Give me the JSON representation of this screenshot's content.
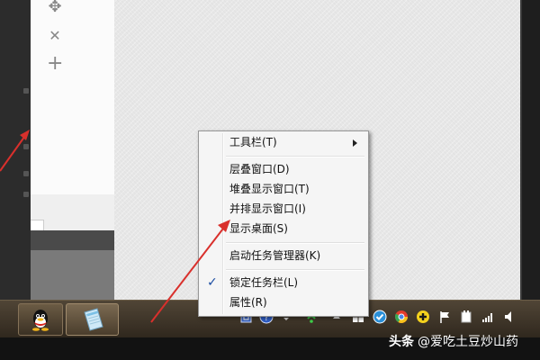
{
  "context_menu": {
    "items": [
      {
        "label": "工具栏(T)",
        "submenu": true
      },
      {
        "label": "层叠窗口(D)"
      },
      {
        "label": "堆叠显示窗口(T)"
      },
      {
        "label": "并排显示窗口(I)"
      },
      {
        "label": "显示桌面(S)"
      },
      {
        "label": "启动任务管理器(K)"
      },
      {
        "label": "锁定任务栏(L)",
        "checked": true,
        "check_mark": "✓"
      },
      {
        "label": "属性(R)"
      }
    ]
  },
  "side_tools": {
    "move_glyph": "✥",
    "close_glyph": "✕",
    "add_glyph": "+"
  },
  "taskbar": {
    "buttons": [
      "qq-icon",
      "notepad-icon"
    ],
    "tray_icons": [
      "keyboard-icon",
      "help-icon",
      "overflow-arrow-icon",
      "wifi-icon",
      "up-arrow-icon",
      "windows-icon",
      "check-icon",
      "chrome-icon",
      "plus-icon",
      "flag-icon",
      "device-icon",
      "signal-icon",
      "speaker-icon"
    ]
  },
  "watermark": {
    "brand": "头条",
    "handle": "@爱吃土豆炒山药"
  },
  "colors": {
    "arrow": "#d9302c",
    "taskbar": "#3f3527",
    "menu_bg": "#f5f5f5",
    "check": "#1c4da3"
  }
}
